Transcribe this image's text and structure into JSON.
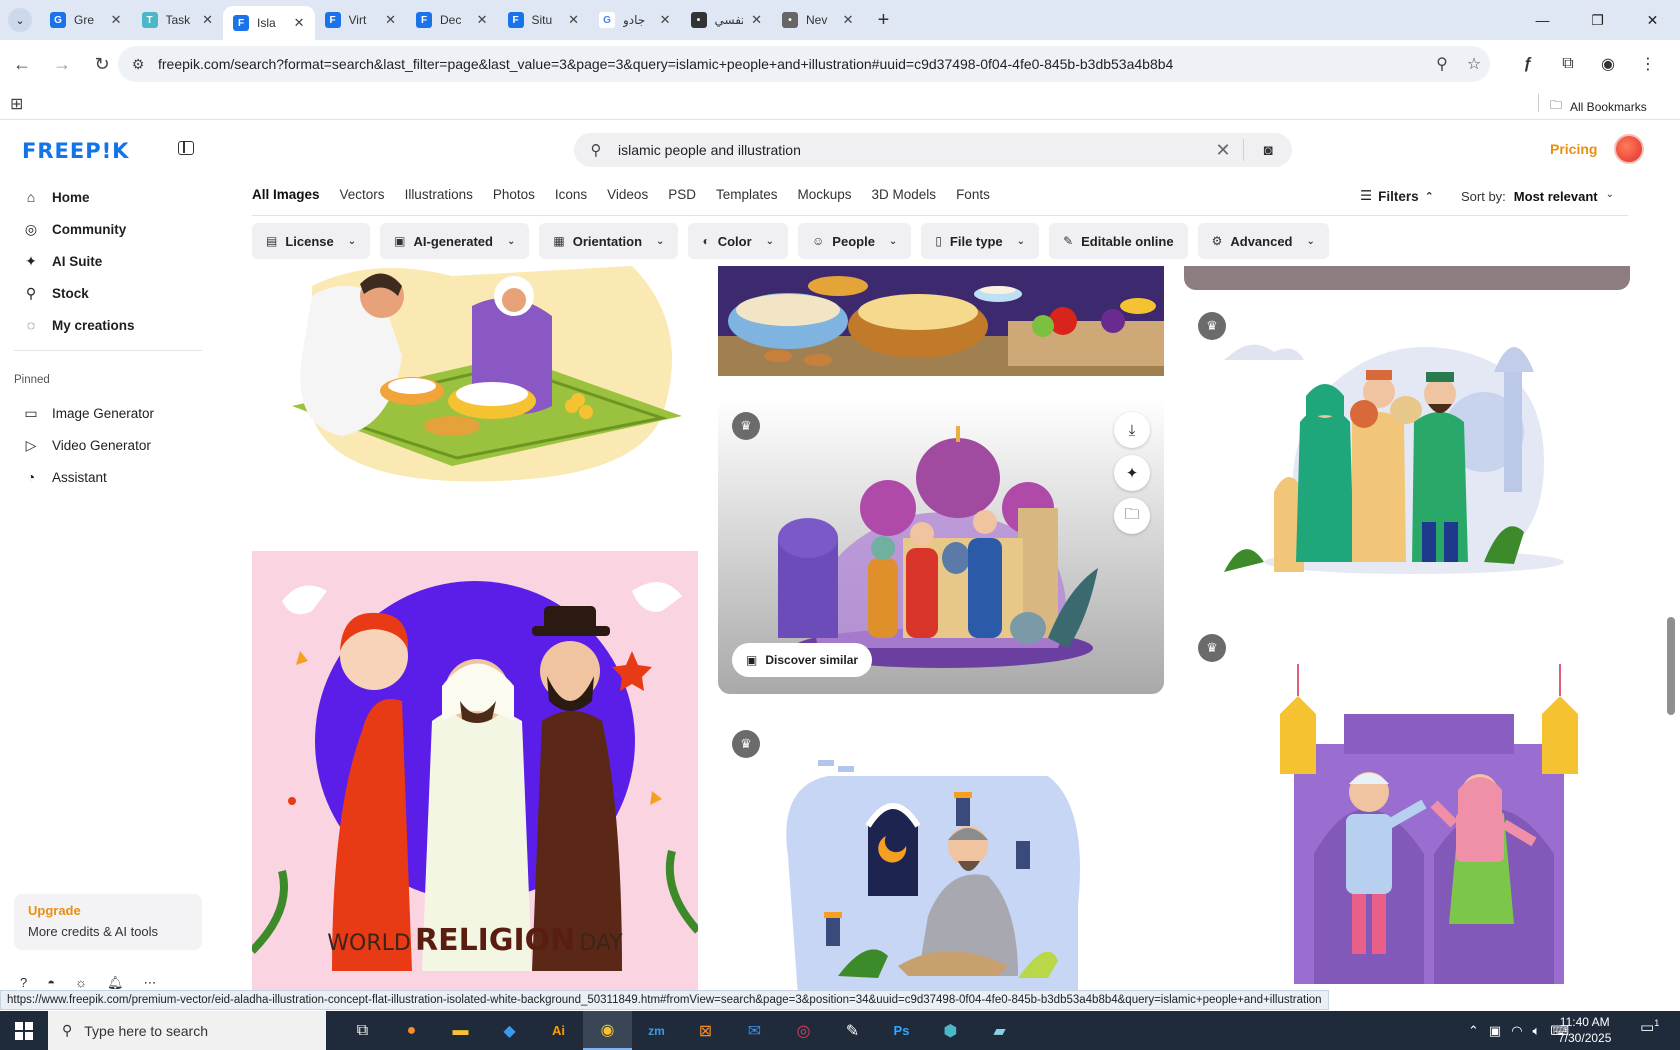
{
  "tabs": {
    "pinned_count": 13,
    "titled": [
      {
        "title": "Gre",
        "color": "#1a73e8",
        "letter": "G"
      },
      {
        "title": "Task",
        "color": "#4ab8c8",
        "letter": "T"
      },
      {
        "title": "Isla",
        "color": "#1a73e8",
        "letter": "F",
        "active": true
      },
      {
        "title": "Virt",
        "color": "#1a73e8",
        "letter": "F"
      },
      {
        "title": "Dec",
        "color": "#1a73e8",
        "letter": "F"
      },
      {
        "title": "Situ",
        "color": "#1a73e8",
        "letter": "F"
      },
      {
        "title": "جادو",
        "color": "#fff",
        "letter": "G"
      },
      {
        "title": "تفسي",
        "color": "#333",
        "letter": "•"
      },
      {
        "title": "Nev",
        "color": "#666",
        "letter": "•"
      }
    ]
  },
  "address": {
    "url": "freepik.com/search?format=search&last_filter=page&last_value=3&page=3&query=islamic+people+and+illustration#uuid=c9d37498-0f04-4fe0-845b-b3db53a4b8b4"
  },
  "bookmarks": {
    "all_label": "All Bookmarks"
  },
  "sidebar": {
    "logo": "FREEP!K",
    "nav": [
      {
        "label": "Home",
        "icon": "⌂"
      },
      {
        "label": "Community",
        "icon": "◎"
      },
      {
        "label": "AI Suite",
        "icon": "✦"
      },
      {
        "label": "Stock",
        "icon": "⚲"
      },
      {
        "label": "My creations",
        "icon": "◌"
      }
    ],
    "pinned_label": "Pinned",
    "pinned": [
      {
        "label": "Image Generator",
        "icon": "▭"
      },
      {
        "label": "Video Generator",
        "icon": "▷"
      },
      {
        "label": "Assistant",
        "icon": "◔"
      }
    ],
    "upgrade_title": "Upgrade",
    "upgrade_sub": "More credits & AI tools"
  },
  "search": {
    "query": "islamic people and illustration"
  },
  "header": {
    "pricing": "Pricing"
  },
  "type_tabs": [
    "All Images",
    "Vectors",
    "Illustrations",
    "Photos",
    "Icons",
    "Videos",
    "PSD",
    "Templates",
    "Mockups",
    "3D Models",
    "Fonts"
  ],
  "filters_label": "Filters",
  "sort": {
    "label": "Sort by:",
    "value": "Most relevant"
  },
  "chips": [
    {
      "label": "License",
      "icon": "▤"
    },
    {
      "label": "AI-generated",
      "icon": "▣"
    },
    {
      "label": "Orientation",
      "icon": "▦"
    },
    {
      "label": "Color",
      "icon": "◐"
    },
    {
      "label": "People",
      "icon": "☺"
    },
    {
      "label": "File type",
      "icon": "▯"
    },
    {
      "label": "Editable online",
      "icon": "✎",
      "no_chevron": true
    },
    {
      "label": "Advanced",
      "icon": "⚙"
    }
  ],
  "card_labels": {
    "discover": "Discover similar",
    "poster_text_1": "WORLD",
    "poster_text_2": "RELIGION",
    "poster_text_3": "DAY"
  },
  "status_url": "https://www.freepik.com/premium-vector/eid-aladha-illustration-concept-flat-illustration-isolated-white-background_50311849.htm#fromView=search&page=3&position=34&uuid=c9d37498-0f04-4fe0-845b-b3db53a4b8b4&query=islamic+people+and+illustration",
  "taskbar": {
    "search_placeholder": "Type here to search",
    "time": "11:40 AM",
    "date": "7/30/2025",
    "notifications": "1"
  }
}
